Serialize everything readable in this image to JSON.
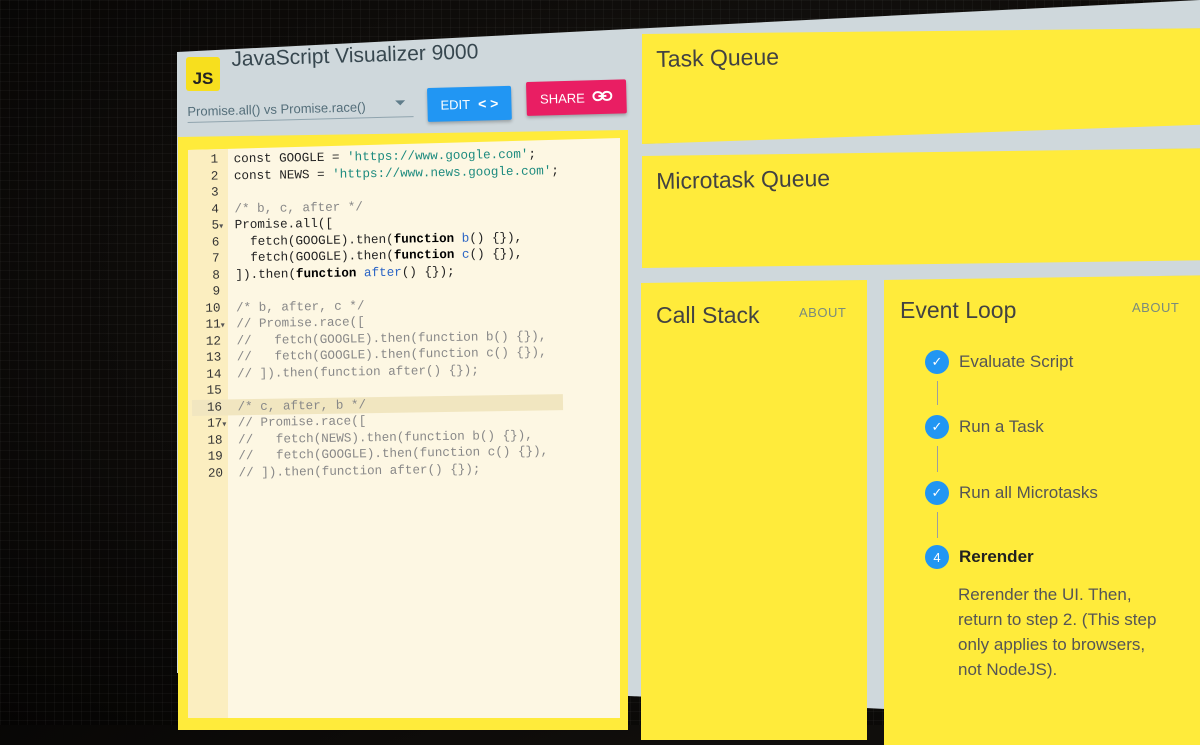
{
  "app": {
    "logo_text": "JS",
    "title": "JavaScript Visualizer 9000"
  },
  "example_select": {
    "value": "Promise.all() vs Promise.race()"
  },
  "buttons": {
    "edit_label": "EDIT",
    "edit_icon": "code-brackets-icon",
    "share_label": "SHARE",
    "share_icon": "link-icon"
  },
  "editor": {
    "active_line": 16,
    "lines": [
      {
        "n": "1",
        "fold": "",
        "text": "const GOOGLE = 'https://www.google.com';"
      },
      {
        "n": "2",
        "fold": "",
        "text": "const NEWS = 'https://www.news.google.com';"
      },
      {
        "n": "3",
        "fold": "",
        "text": ""
      },
      {
        "n": "4",
        "fold": "",
        "text": "/* b, c, after */"
      },
      {
        "n": "5",
        "fold": "▾",
        "text": "Promise.all(["
      },
      {
        "n": "6",
        "fold": "",
        "text": "  fetch(GOOGLE).then(function b() {}),"
      },
      {
        "n": "7",
        "fold": "",
        "text": "  fetch(GOOGLE).then(function c() {}),"
      },
      {
        "n": "8",
        "fold": "",
        "text": "]).then(function after() {});"
      },
      {
        "n": "9",
        "fold": "",
        "text": ""
      },
      {
        "n": "10",
        "fold": "",
        "text": "/* b, after, c */"
      },
      {
        "n": "11",
        "fold": "▾",
        "text": "// Promise.race(["
      },
      {
        "n": "12",
        "fold": "",
        "text": "//   fetch(GOOGLE).then(function b() {}),"
      },
      {
        "n": "13",
        "fold": "",
        "text": "//   fetch(GOOGLE).then(function c() {}),"
      },
      {
        "n": "14",
        "fold": "",
        "text": "// ]).then(function after() {});"
      },
      {
        "n": "15",
        "fold": "",
        "text": ""
      },
      {
        "n": "16",
        "fold": "",
        "text": "/* c, after, b */"
      },
      {
        "n": "17",
        "fold": "▾",
        "text": "// Promise.race(["
      },
      {
        "n": "18",
        "fold": "",
        "text": "//   fetch(NEWS).then(function b() {}),"
      },
      {
        "n": "19",
        "fold": "",
        "text": "//   fetch(GOOGLE).then(function c() {}),"
      },
      {
        "n": "20",
        "fold": "",
        "text": "// ]).then(function after() {});"
      }
    ]
  },
  "panels": {
    "task_queue": "Task Queue",
    "microtask_queue": "Microtask Queue",
    "call_stack": "Call Stack",
    "call_stack_about": "ABOUT",
    "event_loop": "Event Loop",
    "event_loop_about": "ABOUT"
  },
  "event_loop_steps": [
    {
      "marker": "✓",
      "label": "Evaluate Script",
      "state": "done"
    },
    {
      "marker": "✓",
      "label": "Run a Task",
      "state": "done"
    },
    {
      "marker": "✓",
      "label": "Run all Microtasks",
      "state": "done"
    },
    {
      "marker": "4",
      "label": "Rerender",
      "state": "active",
      "description": "Rerender the UI. Then, return to step 2. (This step only applies to browsers, not NodeJS)."
    }
  ],
  "colors": {
    "card_yellow": "#ffeb3b",
    "edit_blue": "#2196f3",
    "share_pink": "#e91e63",
    "panel_gray": "#cfd8dc"
  }
}
